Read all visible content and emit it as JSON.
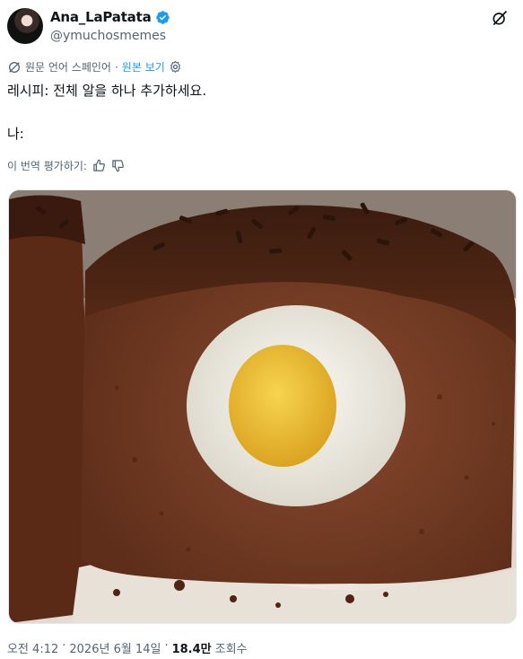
{
  "author": {
    "name": "Ana_LaPatata",
    "handle": "@ymuchosmemes",
    "verified": true
  },
  "translation": {
    "source_label": "원문 언어 스페인어",
    "show_original": "원본 보기"
  },
  "tweet": {
    "line1": "레시피: 전체 알을 하나 추가하세요.",
    "line2": "나:"
  },
  "rate": {
    "label": "이 번역 평가하기:"
  },
  "footer": {
    "time": "오전 4:12",
    "dot1": "·",
    "date": "2026년 6월 14일",
    "dot2": "·",
    "views": "18.4만",
    "views_label": "조회수"
  },
  "colors": {
    "accent": "#1d9bf0",
    "secondary_text": "#536471"
  },
  "icons": {
    "verified": "verified-badge-icon",
    "grok": "grok-icon",
    "translate": "translate-icon",
    "settings": "gear-icon",
    "thumbs_up": "thumbs-up-icon",
    "thumbs_down": "thumbs-down-icon"
  }
}
